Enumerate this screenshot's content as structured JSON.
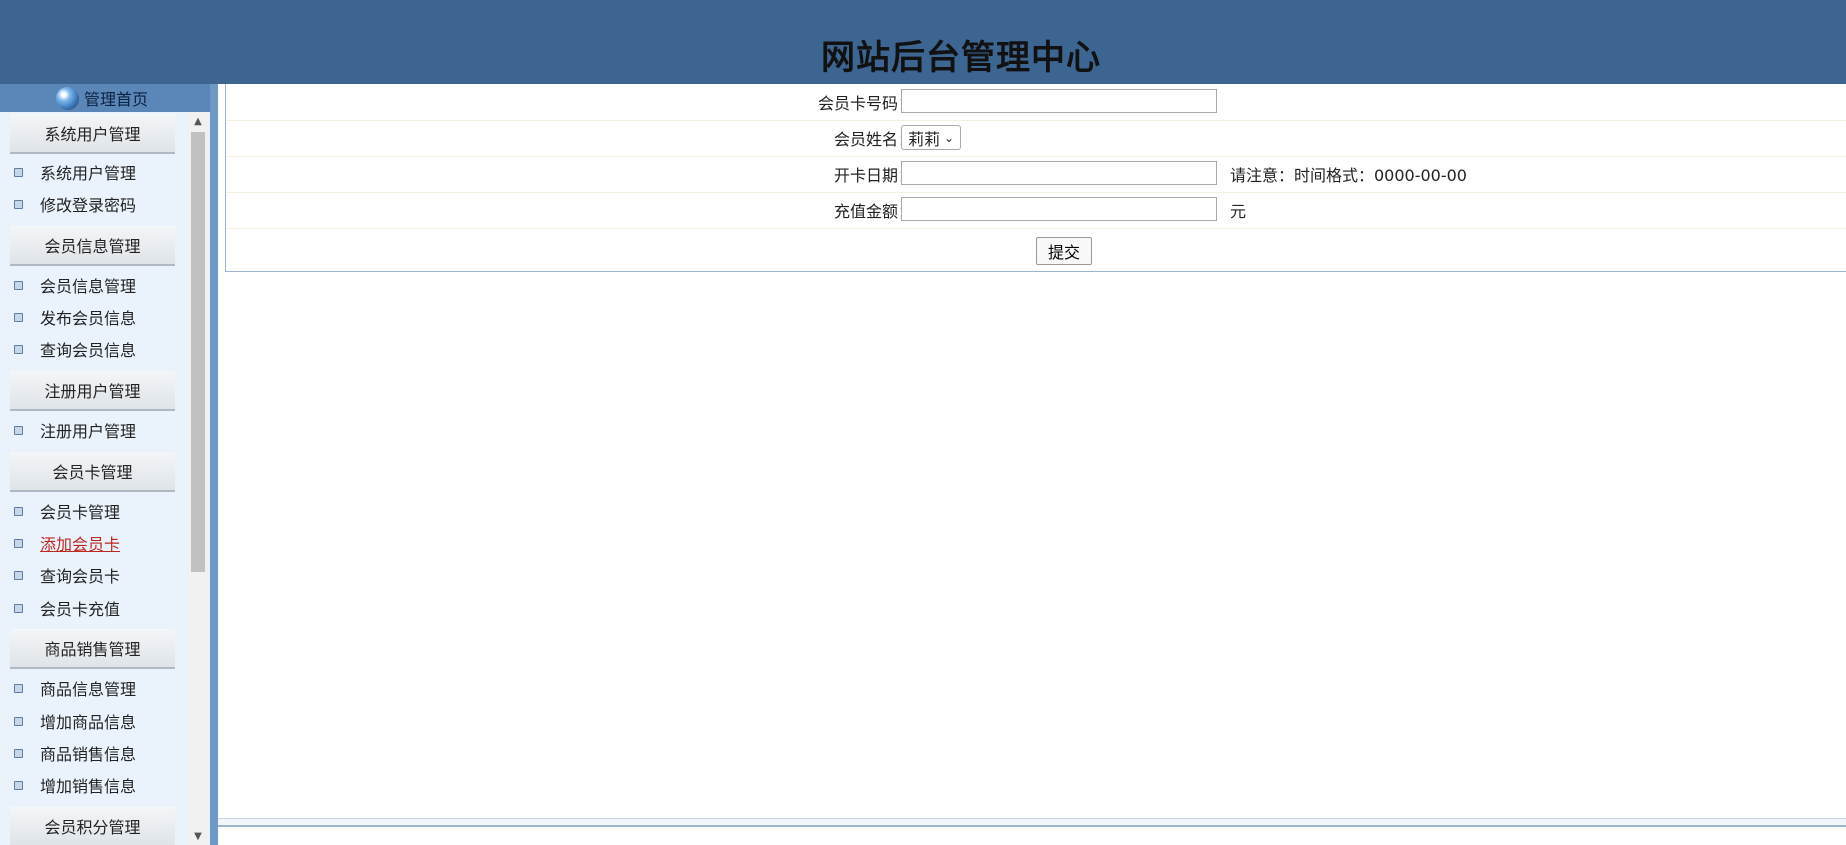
{
  "header": {
    "title": "网站后台管理中心"
  },
  "sidebar": {
    "home_label": "管理首页",
    "groups": [
      {
        "title": "系统用户管理",
        "items": [
          "系统用户管理",
          "修改登录密码"
        ]
      },
      {
        "title": "会员信息管理",
        "items": [
          "会员信息管理",
          "发布会员信息",
          "查询会员信息"
        ]
      },
      {
        "title": "注册用户管理",
        "items": [
          "注册用户管理"
        ]
      },
      {
        "title": "会员卡管理",
        "items": [
          "会员卡管理",
          "添加会员卡",
          "查询会员卡",
          "会员卡充值"
        ]
      },
      {
        "title": "商品销售管理",
        "items": [
          "商品信息管理",
          "增加商品信息",
          "商品销售信息",
          "增加销售信息"
        ]
      },
      {
        "title": "会员积分管理",
        "items": []
      }
    ],
    "active_item": "添加会员卡"
  },
  "form": {
    "card_number_label": "会员卡号码：",
    "card_number_value": "",
    "member_name_label": "会员姓名：",
    "member_name_selected": "莉莉",
    "open_date_label": "开卡日期：",
    "open_date_value": "",
    "open_date_hint": "请注意：时间格式：0000-00-00",
    "amount_label": "充值金额：",
    "amount_value": "",
    "amount_unit": "元",
    "submit_label": "提交"
  },
  "colors": {
    "header_bg": "#3d6592",
    "sidebar_bg": "#eaf3fc",
    "active_link": "#c0281e"
  }
}
